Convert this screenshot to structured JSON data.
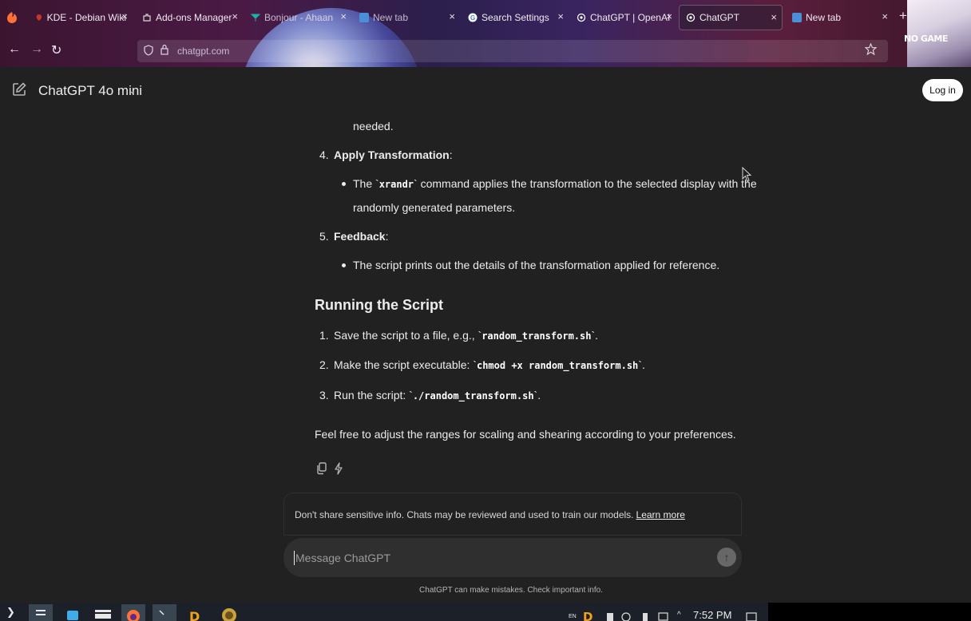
{
  "browser": {
    "tabs": [
      {
        "title": "KDE - Debian Wiki",
        "fav_color": "#c0392b"
      },
      {
        "title": "Add-ons Manager",
        "fav_color": "#dcdcdc"
      },
      {
        "title": "Bonjour - Ahaan",
        "fav_color": "#1fb1a3"
      },
      {
        "title": "New tab",
        "fav_color": "#4c8ed8"
      },
      {
        "title": "Search Settings",
        "fav_color": "#ffffff"
      },
      {
        "title": "ChatGPT | OpenAI",
        "fav_color": "#ffffff"
      },
      {
        "title": "ChatGPT",
        "fav_color": "#ffffff"
      },
      {
        "title": "New tab",
        "fav_color": "#4c8ed8"
      }
    ],
    "close_glyph": "×",
    "new_tab_glyph": "+",
    "tab_list_glyph": "⌵",
    "back_glyph": "←",
    "forward_glyph": "→",
    "reload_glyph": "↻",
    "url": "chatgpt.com",
    "theme_text": "NO GAME"
  },
  "header": {
    "model": "ChatGPT 4o mini",
    "chevron": "⌄",
    "login": "Log in"
  },
  "message": {
    "partial_line": "needed.",
    "item4": {
      "num": "4.",
      "title": "Apply Transformation",
      "colon": ":"
    },
    "item4_bullet": {
      "pre": "The `",
      "code": "xrandr",
      "post": "` command applies the transformation to the selected display with the",
      "line2": "randomly generated parameters."
    },
    "item5": {
      "num": "5.",
      "title": "Feedback",
      "colon": ":"
    },
    "item5_bullet": "The script prints out the details of the transformation applied for reference.",
    "heading": "Running the Script",
    "steps": [
      {
        "num": "1.",
        "pre": "Save the script to a file, e.g., `",
        "code": "random_transform.sh",
        "post": "`."
      },
      {
        "num": "2.",
        "pre": "Make the script executable: `",
        "code": "chmod +x random_transform.sh",
        "post": "`."
      },
      {
        "num": "3.",
        "pre": "Run the script: `",
        "code": "./random_transform.sh",
        "post": "`."
      }
    ],
    "closing": "Feel free to adjust the ranges for scaling and shearing according to your preferences."
  },
  "composer": {
    "disclaimer": "Don't share sensitive info. Chats may be reviewed and used to train our models.",
    "learn_more": "Learn more",
    "placeholder": "Message ChatGPT",
    "send_glyph": "↑",
    "footnote": "ChatGPT can make mistakes. Check important info."
  },
  "taskbar": {
    "time": "7:52 PM",
    "lang": "EN"
  }
}
